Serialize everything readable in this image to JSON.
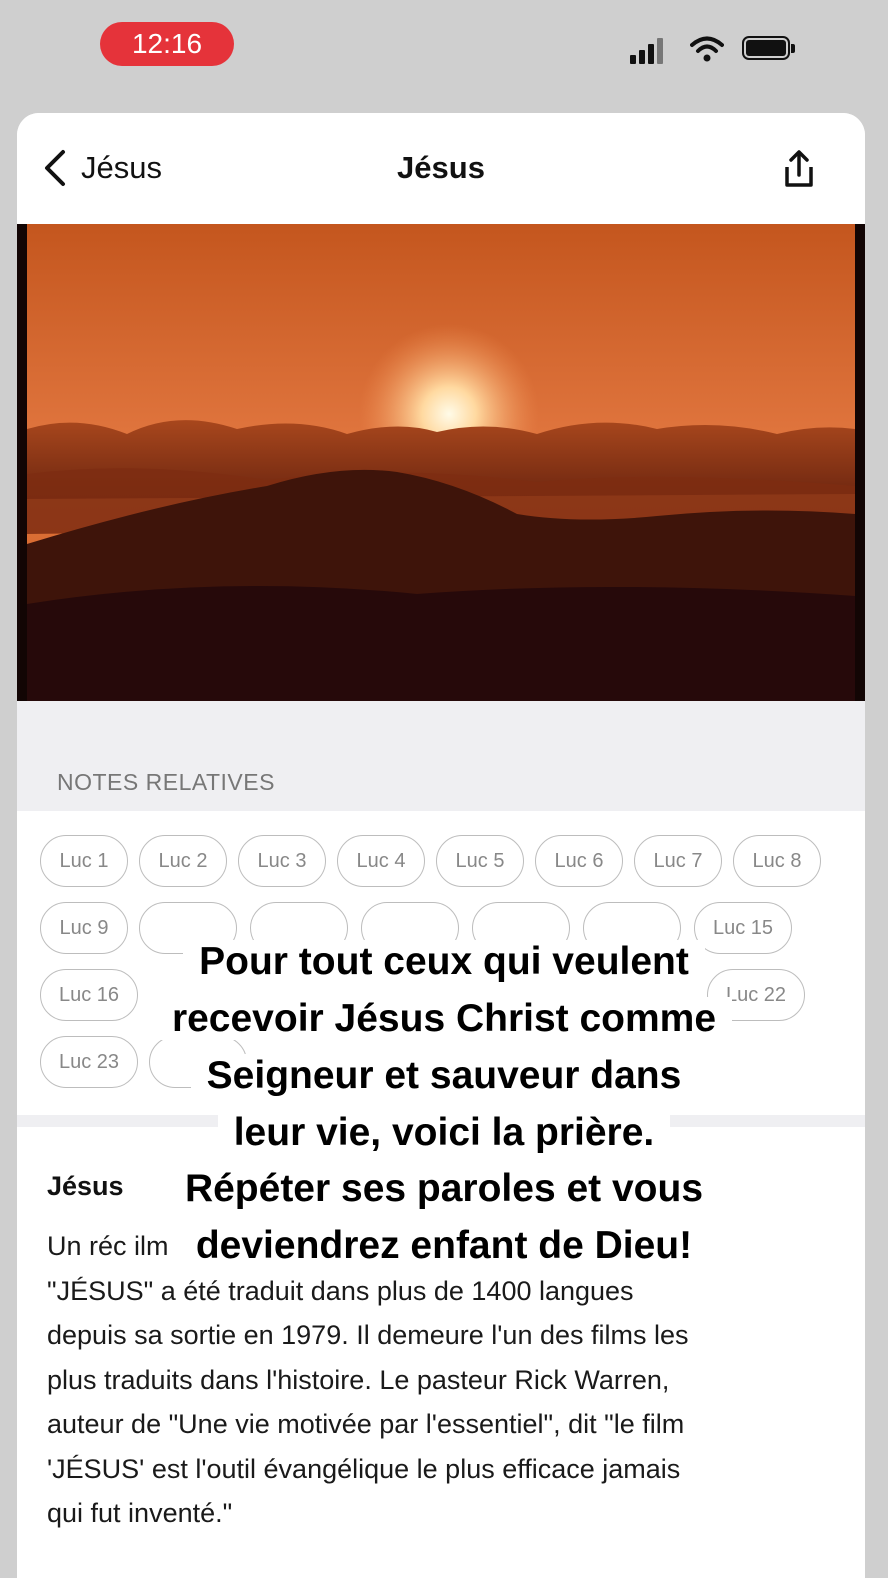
{
  "status_bar": {
    "time": "12:16"
  },
  "nav": {
    "back_label": "Jésus",
    "title": "Jésus"
  },
  "notes": {
    "header": "NOTES RELATIVES",
    "chips": [
      "Luc 1",
      "Luc 2",
      "Luc 3",
      "Luc 4",
      "Luc 5",
      "Luc 6",
      "Luc 7",
      "Luc 8",
      "Luc 9",
      "Luc 15",
      "Luc 16",
      "Luc 22",
      "Luc 23"
    ]
  },
  "article": {
    "title": "Jésus",
    "body": "Un réc                                                                            ilm\n\"JÉSUS\" a été traduit dans plus de 1400 langues\ndepuis sa sortie en 1979. Il demeure l'un des films les\nplus traduits dans l'histoire. Le pasteur Rick Warren,\nauteur de \"Une vie motivée par l'essentiel\", dit \"le film\n'JÉSUS' est l'outil évangélique le plus efficace jamais\nqui fut inventé.\""
  },
  "caption": {
    "lines": [
      "Pour tout ceux qui veulent",
      "recevoir Jésus Christ comme",
      "Seigneur et sauveur dans",
      "leur vie, voici la prière.",
      "Répéter ses paroles et vous",
      "deviendrez enfant de Dieu!"
    ]
  }
}
